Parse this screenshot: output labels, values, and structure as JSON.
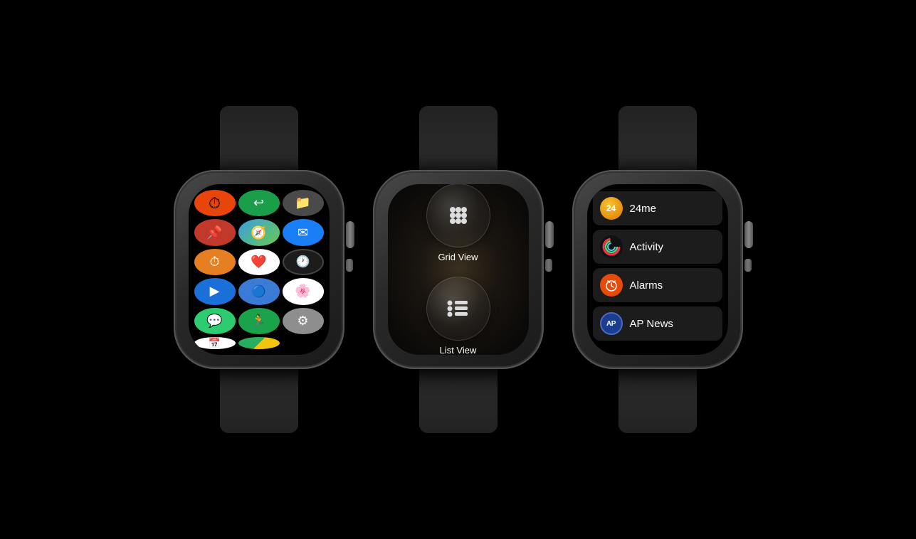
{
  "watches": [
    {
      "id": "watch-grid",
      "apps": [
        {
          "name": "Timer",
          "emoji": "⏱️",
          "class": "icon-timer"
        },
        {
          "name": "Todoist",
          "emoji": "↩",
          "class": "icon-todo"
        },
        {
          "name": "Files",
          "emoji": "📁",
          "class": "icon-files"
        },
        {
          "name": "Maps",
          "emoji": "🧭",
          "class": "icon-maps"
        },
        {
          "name": "Mail",
          "emoji": "✉️",
          "class": "icon-mail"
        },
        {
          "name": "Clock",
          "emoji": "⏰",
          "class": "icon-clock2"
        },
        {
          "name": "Health",
          "emoji": "❤️",
          "class": "icon-health"
        },
        {
          "name": "Clock2",
          "emoji": "🕐",
          "class": "icon-clock"
        },
        {
          "name": "TV",
          "emoji": "▶️",
          "class": "icon-tv"
        },
        {
          "name": "Workflow",
          "emoji": "🔵",
          "class": "icon-workflow"
        },
        {
          "name": "Photos",
          "emoji": "🌼",
          "class": "icon-photos"
        },
        {
          "name": "Messages",
          "emoji": "💬",
          "class": "icon-messages"
        },
        {
          "name": "Fitness",
          "emoji": "🏃",
          "class": "icon-fitness"
        },
        {
          "name": "Settings",
          "emoji": "⚙️",
          "class": "icon-settings"
        },
        {
          "name": "Calendar",
          "emoji": "📅",
          "class": "icon-calendar"
        }
      ]
    },
    {
      "id": "watch-selector",
      "options": [
        {
          "label": "Grid View",
          "icon": "⠿"
        },
        {
          "label": "List View",
          "icon": "☰"
        }
      ]
    },
    {
      "id": "watch-list",
      "items": [
        {
          "name": "24me",
          "icon_text": "24",
          "icon_class": "licon-24me"
        },
        {
          "name": "Activity",
          "icon_text": "",
          "icon_class": "licon-activity"
        },
        {
          "name": "Alarms",
          "icon_text": "⏰",
          "icon_class": "licon-alarms"
        },
        {
          "name": "AP News",
          "icon_text": "AP",
          "icon_class": "licon-apnews"
        }
      ]
    }
  ]
}
